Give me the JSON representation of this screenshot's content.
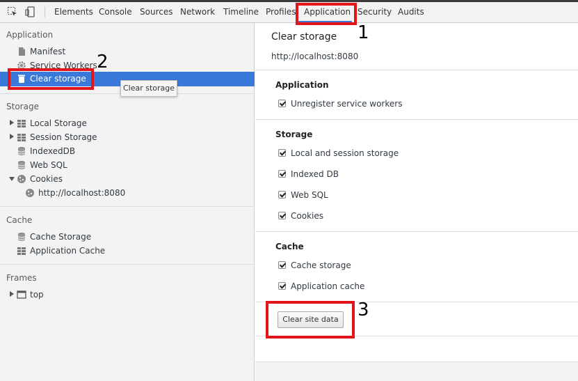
{
  "toolbar": {
    "tabs": [
      {
        "label": "Elements"
      },
      {
        "label": "Console"
      },
      {
        "label": "Sources"
      },
      {
        "label": "Network"
      },
      {
        "label": "Timeline"
      },
      {
        "label": "Profiles"
      },
      {
        "label": "Application",
        "active": true
      },
      {
        "label": "Security"
      },
      {
        "label": "Audits"
      }
    ],
    "inspect_icon": "inspect-element-icon",
    "device_icon": "device-mode-icon",
    "active_color": "#3879d9"
  },
  "sidebar": {
    "sections": {
      "application": {
        "title": "Application",
        "items": [
          "Manifest",
          "Service Workers",
          "Clear storage"
        ]
      },
      "storage": {
        "title": "Storage",
        "items": [
          "Local Storage",
          "Session Storage",
          "IndexedDB",
          "Web SQL",
          "Cookies",
          "http://localhost:8080"
        ]
      },
      "cache": {
        "title": "Cache",
        "items": [
          "Cache Storage",
          "Application Cache"
        ]
      },
      "frames": {
        "title": "Frames",
        "items": [
          "top"
        ]
      }
    },
    "selected_item": "Clear storage",
    "tooltip": "Clear storage",
    "selected_color": "#3879d9"
  },
  "main": {
    "title": "Clear storage",
    "origin": "http://localhost:8080",
    "groups": {
      "application": {
        "title": "Application",
        "options": [
          {
            "label": "Unregister service workers",
            "checked": true
          }
        ]
      },
      "storage": {
        "title": "Storage",
        "options": [
          {
            "label": "Local and session storage",
            "checked": true
          },
          {
            "label": "Indexed DB",
            "checked": true
          },
          {
            "label": "Web SQL",
            "checked": true
          },
          {
            "label": "Cookies",
            "checked": true
          }
        ]
      },
      "cache": {
        "title": "Cache",
        "options": [
          {
            "label": "Cache storage",
            "checked": true
          },
          {
            "label": "Application cache",
            "checked": true
          }
        ]
      }
    },
    "clear_button": "Clear site data"
  },
  "annotations": {
    "color": "#e2141c",
    "labels": [
      "1",
      "2",
      "3"
    ]
  }
}
